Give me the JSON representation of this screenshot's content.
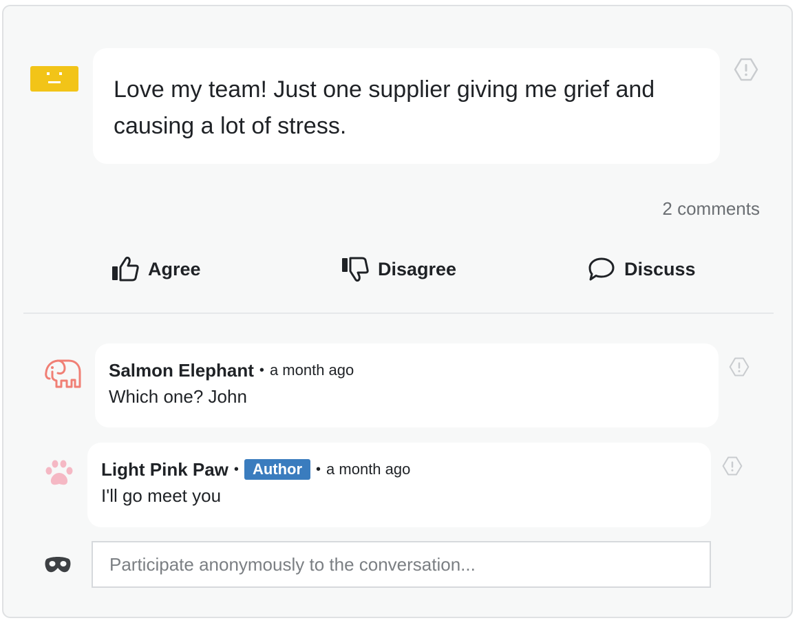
{
  "post": {
    "mood_icon": "neutral-face-icon",
    "mood_color": "#f2c418",
    "text": "Love my team! Just one supplier giving me grief and causing a lot of stress.",
    "comment_count": "2 comments"
  },
  "actions": {
    "agree": "Agree",
    "disagree": "Disagree",
    "discuss": "Discuss"
  },
  "comments": [
    {
      "name": "Salmon Elephant",
      "avatar_icon": "elephant-icon",
      "avatar_color": "#f07f75",
      "time": "a month ago",
      "text": "Which one? John"
    },
    {
      "name": "Light Pink Paw",
      "avatar_icon": "paw-icon",
      "avatar_color": "#f5b8c4",
      "badge": "Author",
      "badge_color": "#3a7cbe",
      "time": "a month ago",
      "text": "I'll go meet you"
    }
  ],
  "composer": {
    "avatar_icon": "anonymous-mask-icon",
    "placeholder": "Participate anonymously to the conversation..."
  }
}
